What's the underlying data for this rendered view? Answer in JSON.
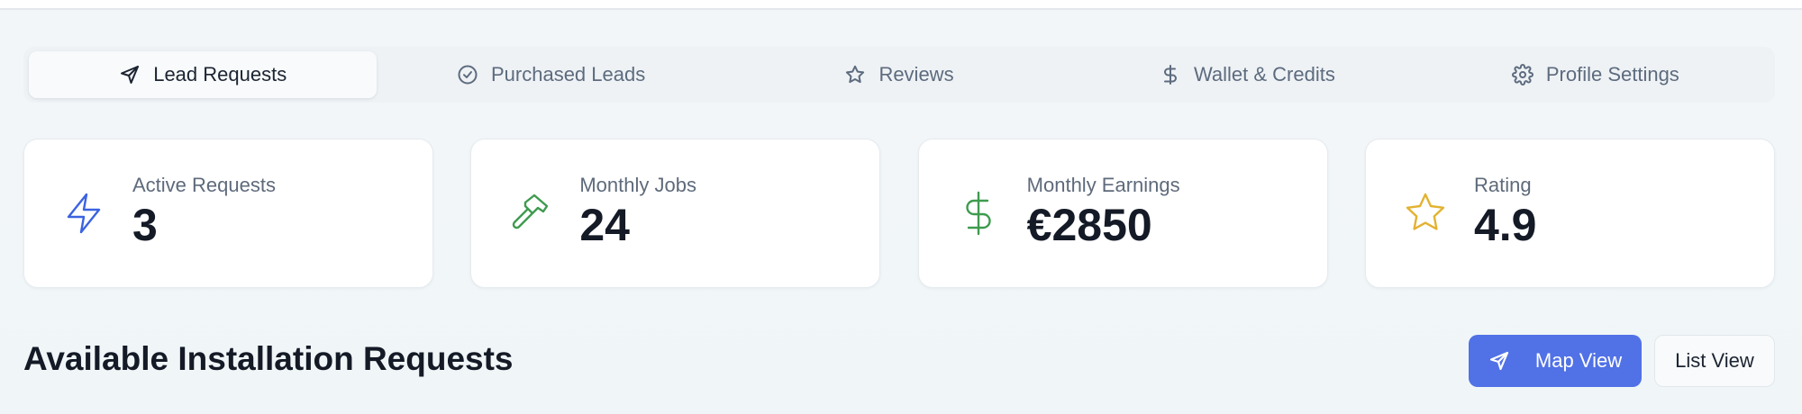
{
  "tabs": [
    {
      "label": "Lead Requests",
      "icon": "send-icon",
      "active": true
    },
    {
      "label": "Purchased Leads",
      "icon": "check-circle-icon",
      "active": false
    },
    {
      "label": "Reviews",
      "icon": "star-icon",
      "active": false
    },
    {
      "label": "Wallet & Credits",
      "icon": "dollar-icon",
      "active": false
    },
    {
      "label": "Profile Settings",
      "icon": "gear-icon",
      "active": false
    }
  ],
  "stats": [
    {
      "label": "Active Requests",
      "value": "3",
      "icon": "lightning-icon",
      "color": "#3b63e0"
    },
    {
      "label": "Monthly Jobs",
      "value": "24",
      "icon": "hammer-icon",
      "color": "#3e9b4f"
    },
    {
      "label": "Monthly Earnings",
      "value": "€2850",
      "icon": "dollar-icon",
      "color": "#3e9b4f"
    },
    {
      "label": "Rating",
      "value": "4.9",
      "icon": "star-icon",
      "color": "#e2b231"
    }
  ],
  "section": {
    "title": "Available Installation Requests",
    "map_view_label": "Map View",
    "list_view_label": "List View"
  },
  "colors": {
    "accent": "#5171e6",
    "background": "#f0f6f7"
  }
}
